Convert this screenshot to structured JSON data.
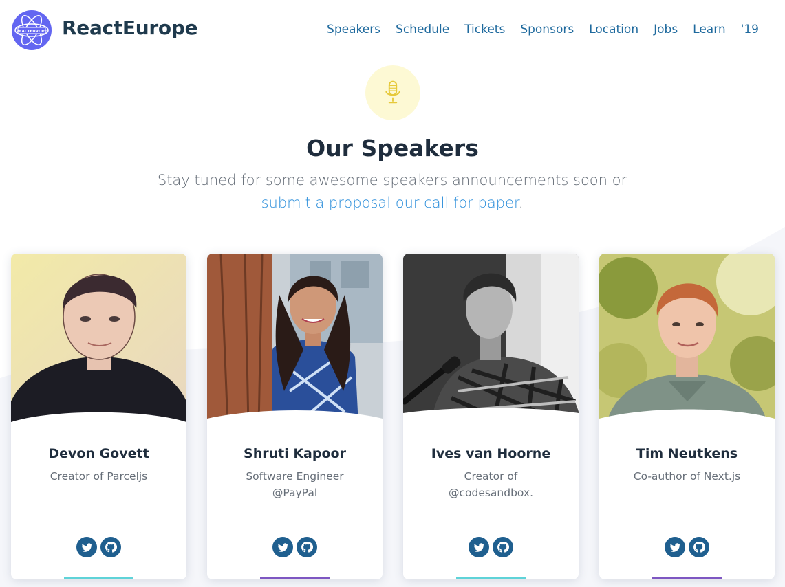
{
  "header": {
    "brand": "ReactEurope",
    "logo_text": "REACTEUROPE",
    "nav": [
      "Speakers",
      "Schedule",
      "Tickets",
      "Sponsors",
      "Location",
      "Jobs",
      "Learn",
      "'19"
    ]
  },
  "hero": {
    "icon": "microphone-icon",
    "title": "Our Speakers",
    "subtitle": "Stay tuned for some awesome speakers announcements soon or",
    "link_text": "submit a proposal our call for paper",
    "link_suffix": "."
  },
  "colors": {
    "brand": "#6366f1",
    "nav_link": "#1f6a9e",
    "link": "#2d8fdb",
    "social": "#1f5f8f",
    "accent_teal": "#5fd3d8",
    "accent_purple": "#7e57c2"
  },
  "speakers": [
    {
      "name": "Devon Govett",
      "role": "Creator of Parceljs",
      "accent": "#5fd3d8",
      "social_icons": [
        "twitter-icon",
        "github-icon"
      ]
    },
    {
      "name": "Shruti Kapoor",
      "role": "Software Engineer @PayPal",
      "accent": "#7e57c2",
      "social_icons": [
        "twitter-icon",
        "github-icon"
      ]
    },
    {
      "name": "Ives van Hoorne",
      "role": "Creator of @codesandbox.",
      "accent": "#5fd3d8",
      "social_icons": [
        "twitter-icon",
        "github-icon"
      ]
    },
    {
      "name": "Tim Neutkens",
      "role": "Co-author of Next.js",
      "accent": "#7e57c2",
      "social_icons": [
        "twitter-icon",
        "github-icon"
      ]
    }
  ]
}
